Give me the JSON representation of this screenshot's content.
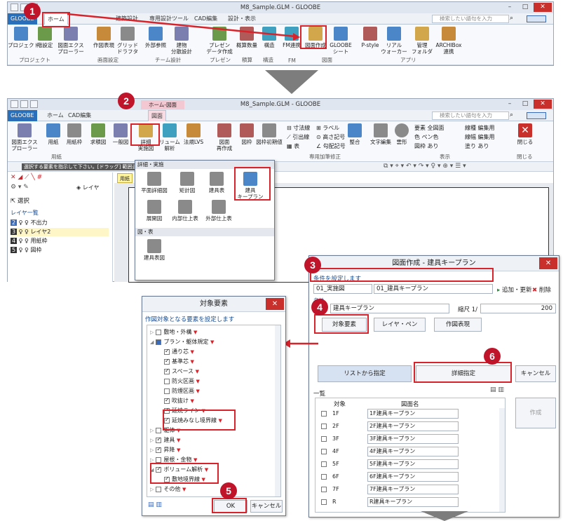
{
  "steps": [
    "1",
    "2",
    "3",
    "4",
    "5",
    "6"
  ],
  "win1": {
    "title": "M8_Sample.GLM - GLOOBE",
    "tabs": [
      "GLOOBE",
      "ホーム",
      "建築設計",
      "専用設計ツール",
      "CAD編集",
      "設計・表示"
    ],
    "search_placeholder": "検索したい語句を入力",
    "buttons": [
      {
        "label": "プロジェクト",
        "group": "プロジェクト"
      },
      {
        "label": "階設定",
        "group": "プロジェクト"
      },
      {
        "label": "図面エクス\nプローラー",
        "group": "プロジェクト"
      },
      {
        "label": "作図表現",
        "group": "画面設定"
      },
      {
        "label": "グリッド\nドラフタ",
        "group": "画面設定"
      },
      {
        "label": "外部参照",
        "group": "チーム設計"
      },
      {
        "label": "建物\n分散設計",
        "group": "チーム設計"
      },
      {
        "label": "プレゼン\nデータ作成",
        "group": "プレゼン"
      },
      {
        "label": "概算数量",
        "group": "積算"
      },
      {
        "label": "構造",
        "group": "構造"
      },
      {
        "label": "FM連携",
        "group": "FM"
      },
      {
        "label": "図面作成",
        "group": "図面"
      },
      {
        "label": "GLOOBE\nシート",
        "group": "図面"
      },
      {
        "label": "P-style",
        "group": "アプリ"
      },
      {
        "label": "リアル\nウォーカー",
        "group": "アプリ"
      },
      {
        "label": "管理\nフォルダ",
        "group": "アプリ"
      },
      {
        "label": "ARCHIBox\n連携",
        "group": "アプリ"
      }
    ],
    "groups": [
      "プロジェクト",
      "画面設定",
      "チーム設計",
      "プレゼン",
      "積算",
      "構造",
      "FM",
      "図面",
      "アプリ"
    ]
  },
  "win2": {
    "title": "M8_Sample.GLM - GLOOBE",
    "tabs": [
      "GLOOBE",
      "ホーム",
      "CAD編集",
      "ホーム-図面",
      "図面"
    ],
    "search_placeholder": "検索したい語句を入力",
    "buttons": [
      "図面エクス\nプローラー",
      "用紙",
      "用紙枠",
      "求積図",
      "一般図",
      "詳細\n実施図",
      "リューム\n解析",
      "法規LVS",
      "図面\n再作成",
      "図枠",
      "図枠初期値"
    ],
    "annot_buttons": [
      "寸法線",
      "ラベル",
      "引出線",
      "高さ記号",
      "表",
      "勾配記号",
      "整合",
      "文字編集",
      "雲形"
    ],
    "props": {
      "youso": "要素 全図面",
      "iro": "色 ペン色",
      "zuwaku": "図枠 あり",
      "senshu": "線種 編集用",
      "senpuku": "線幅 編集用",
      "nuri": "塗り あり"
    },
    "close_label": "閉じる",
    "groups": [
      "用紙",
      "専用加筆修正",
      "表示",
      "閉じる"
    ],
    "hint": "選択する要素を指示して下さい。[ドラッグ] 範囲選",
    "layer_panel": {
      "select": "選択",
      "list_title": "レイヤ一覧",
      "rows": [
        {
          "no": "2",
          "name": "不出力"
        },
        {
          "no": "3",
          "name": "レイヤ2"
        },
        {
          "no": "4",
          "name": "用紙枠"
        },
        {
          "no": "5",
          "name": "図枠"
        }
      ]
    },
    "layer_btn": "レイヤ",
    "sheet_tab": "用紙全"
  },
  "dropdown": {
    "header": "詳細・実施",
    "items": [
      "平面詳細図",
      "矩計図",
      "建具表",
      "建具\nキープラン",
      "展開図",
      "内部仕上表",
      "外部仕上表"
    ],
    "section2": "図・表",
    "items2": [
      "建具表図"
    ]
  },
  "dlg_keyplan": {
    "title": "図面作成 - 建具キープラン",
    "cond_label": "条件を設定します",
    "type_val": "01_実施図",
    "sub_val": "01_建具キープラン",
    "add_label": "追加・更新",
    "del_label": "削除",
    "name_label": "名前",
    "name_val": "建具キープラン",
    "scale_label": "縮尺 1/",
    "scale_val": "200",
    "btn_target": "対象要素",
    "btn_layer": "レイヤ・ペン",
    "btn_style": "作図表現",
    "btn_list": "リストから指定",
    "btn_detail": "詳細指定",
    "btn_cancel": "キャンセル",
    "list_label": "一覧",
    "col_target": "対象",
    "col_name": "図面名",
    "btn_create": "作成",
    "rows": [
      {
        "floor": "1F",
        "name": "1F建具キープラン"
      },
      {
        "floor": "2F",
        "name": "2F建具キープラン"
      },
      {
        "floor": "3F",
        "name": "3F建具キープラン"
      },
      {
        "floor": "4F",
        "name": "4F建具キープラン"
      },
      {
        "floor": "5F",
        "name": "5F建具キープラン"
      },
      {
        "floor": "6F",
        "name": "6F建具キープラン"
      },
      {
        "floor": "7F",
        "name": "7F建具キープラン"
      },
      {
        "floor": "R",
        "name": "R建具キープラン"
      }
    ]
  },
  "dlg_target": {
    "title": "対象要素",
    "subtitle": "作図対象となる要素を設定します",
    "tree": [
      {
        "label": "敷地・外構",
        "indent": 0,
        "state": "off",
        "arrow": "▷"
      },
      {
        "label": "プラン・躯体規定",
        "indent": 0,
        "state": "part",
        "arrow": "◢"
      },
      {
        "label": "通り芯",
        "indent": 1,
        "state": "on"
      },
      {
        "label": "基準芯",
        "indent": 1,
        "state": "on"
      },
      {
        "label": "スペース",
        "indent": 1,
        "state": "on"
      },
      {
        "label": "防火区画",
        "indent": 1,
        "state": "off"
      },
      {
        "label": "防煙区画",
        "indent": 1,
        "state": "off"
      },
      {
        "label": "吹抜け",
        "indent": 1,
        "state": "on"
      },
      {
        "label": "延焼ライン",
        "indent": 1,
        "state": "on"
      },
      {
        "label": "延焼みなし境界線",
        "indent": 1,
        "state": "on"
      },
      {
        "label": "躯体",
        "indent": 0,
        "state": "off",
        "arrow": "▷"
      },
      {
        "label": "建具",
        "indent": 0,
        "state": "on",
        "arrow": "▷"
      },
      {
        "label": "昇降",
        "indent": 0,
        "state": "on",
        "arrow": "▷"
      },
      {
        "label": "屋根・金物",
        "indent": 0,
        "state": "off",
        "arrow": "▷"
      },
      {
        "label": "ボリューム解析",
        "indent": 0,
        "state": "on",
        "arrow": "◢"
      },
      {
        "label": "敷地境界線",
        "indent": 1,
        "state": "on"
      },
      {
        "label": "その他",
        "indent": 0,
        "state": "off",
        "arrow": "▷"
      }
    ],
    "ok": "OK",
    "cancel": "キャンセル"
  }
}
